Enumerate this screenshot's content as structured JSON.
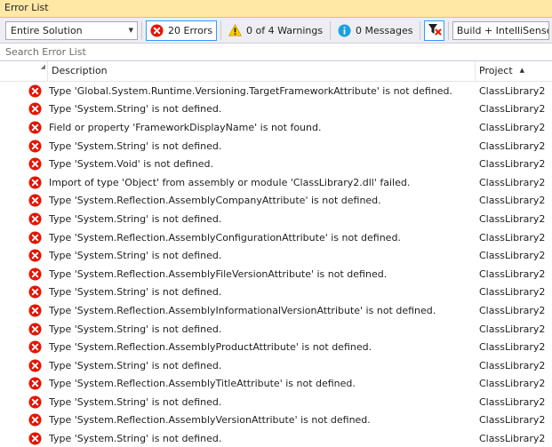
{
  "window": {
    "title": "Error List"
  },
  "toolbar": {
    "scope": "Entire Solution",
    "errors_label": "20 Errors",
    "warnings_label": "0 of 4 Warnings",
    "messages_label": "0 Messages",
    "build_source": "Build + IntelliSense"
  },
  "search": {
    "placeholder": "Search Error List"
  },
  "columns": {
    "description": "Description",
    "project": "Project"
  },
  "colors": {
    "error": "#e51400",
    "warning": "#ffcc00",
    "info": "#1ba1e2",
    "title_bar": "#ffe8a6"
  },
  "rows": [
    {
      "description": "Type 'Global.System.Runtime.Versioning.TargetFrameworkAttribute' is not defined.",
      "project": "ClassLibrary2"
    },
    {
      "description": "Type 'System.String' is not defined.",
      "project": "ClassLibrary2"
    },
    {
      "description": "Field or property 'FrameworkDisplayName' is not found.",
      "project": "ClassLibrary2"
    },
    {
      "description": "Type 'System.String' is not defined.",
      "project": "ClassLibrary2"
    },
    {
      "description": "Type 'System.Void' is not defined.",
      "project": "ClassLibrary2"
    },
    {
      "description": "Import of type 'Object' from assembly or module 'ClassLibrary2.dll' failed.",
      "project": "ClassLibrary2"
    },
    {
      "description": "Type 'System.Reflection.AssemblyCompanyAttribute' is not defined.",
      "project": "ClassLibrary2"
    },
    {
      "description": "Type 'System.String' is not defined.",
      "project": "ClassLibrary2"
    },
    {
      "description": "Type 'System.Reflection.AssemblyConfigurationAttribute' is not defined.",
      "project": "ClassLibrary2"
    },
    {
      "description": "Type 'System.String' is not defined.",
      "project": "ClassLibrary2"
    },
    {
      "description": "Type 'System.Reflection.AssemblyFileVersionAttribute' is not defined.",
      "project": "ClassLibrary2"
    },
    {
      "description": "Type 'System.String' is not defined.",
      "project": "ClassLibrary2"
    },
    {
      "description": "Type 'System.Reflection.AssemblyInformationalVersionAttribute' is not defined.",
      "project": "ClassLibrary2"
    },
    {
      "description": "Type 'System.String' is not defined.",
      "project": "ClassLibrary2"
    },
    {
      "description": "Type 'System.Reflection.AssemblyProductAttribute' is not defined.",
      "project": "ClassLibrary2"
    },
    {
      "description": "Type 'System.String' is not defined.",
      "project": "ClassLibrary2"
    },
    {
      "description": "Type 'System.Reflection.AssemblyTitleAttribute' is not defined.",
      "project": "ClassLibrary2"
    },
    {
      "description": "Type 'System.String' is not defined.",
      "project": "ClassLibrary2"
    },
    {
      "description": "Type 'System.Reflection.AssemblyVersionAttribute' is not defined.",
      "project": "ClassLibrary2"
    },
    {
      "description": "Type 'System.String' is not defined.",
      "project": "ClassLibrary2"
    }
  ]
}
